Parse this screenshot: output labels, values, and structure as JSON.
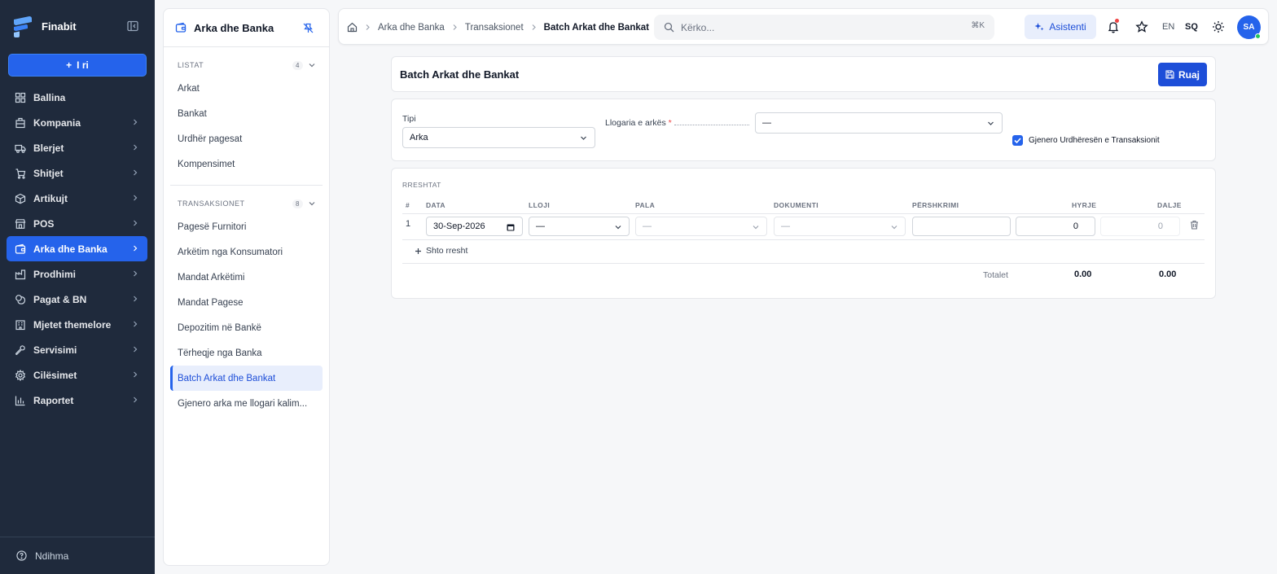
{
  "app": {
    "name": "Finabit",
    "new_label": "I ri",
    "help_label": "Ndihma"
  },
  "nav": {
    "items": [
      {
        "label": "Ballina",
        "icon": "dashboard-icon"
      },
      {
        "label": "Kompania",
        "icon": "building-icon"
      },
      {
        "label": "Blerjet",
        "icon": "truck-icon"
      },
      {
        "label": "Shitjet",
        "icon": "cart-icon"
      },
      {
        "label": "Artikujt",
        "icon": "box-icon"
      },
      {
        "label": "POS",
        "icon": "store-icon"
      },
      {
        "label": "Arka dhe Banka",
        "icon": "wallet-icon",
        "active": true
      },
      {
        "label": "Prodhimi",
        "icon": "factory-icon"
      },
      {
        "label": "Pagat & BN",
        "icon": "coins-icon"
      },
      {
        "label": "Mjetet themelore",
        "icon": "assets-icon"
      },
      {
        "label": "Servisimi",
        "icon": "wrench-icon"
      },
      {
        "label": "Cilësimet",
        "icon": "gear-icon"
      },
      {
        "label": "Raportet",
        "icon": "chart-icon"
      }
    ]
  },
  "panel": {
    "title": "Arka dhe Banka",
    "sections": [
      {
        "title": "LISTAT",
        "count": "4",
        "items": [
          "Arkat",
          "Bankat",
          "Urdhër pagesat",
          "Kompensimet"
        ]
      },
      {
        "title": "TRANSAKSIONET",
        "count": "8",
        "items": [
          "Pagesë Furnitori",
          "Arkëtim nga Konsumatori",
          "Mandat Arkëtimi",
          "Mandat Pagese",
          "Depozitim në Bankë",
          "Tërheqje nga Banka",
          "Batch Arkat dhe Bankat",
          "Gjenero arka me llogari kalim..."
        ]
      }
    ]
  },
  "topbar": {
    "crumbs": [
      "Arka dhe Banka",
      "Transaksionet",
      "Batch Arkat dhe Bankat"
    ],
    "search_placeholder": "Kërko...",
    "search_shortcut": "⌘K",
    "assistant_label": "Asistenti",
    "lang_en": "EN",
    "lang_sq": "SQ",
    "avatar_initials": "SA"
  },
  "page": {
    "title": "Batch Arkat dhe Bankat",
    "save_label": "Ruaj",
    "tipi_label": "Tipi",
    "tipi_value": "Arka",
    "llogaria_label": "Llogaria e arkës",
    "llogaria_value": "—",
    "generate_label": "Gjenero Urdhëresën e Transaksionit",
    "generate_checked": true
  },
  "rows": {
    "section_title": "RRESHTAT",
    "headers": [
      "#",
      "DATA",
      "LLOJI",
      "PALA",
      "DOKUMENTI",
      "PËRSHKRIMI",
      "HYRJE",
      "DALJE"
    ],
    "items": [
      {
        "num": "1",
        "date": "30-Sep-2026",
        "lloji": "—",
        "pala": "—",
        "dokumenti": "—",
        "pershkrimi": "",
        "hyrje": "0",
        "dalje": "0"
      }
    ],
    "add_label": "Shto rresht",
    "totals_label": "Totalet",
    "total_hyrje": "0.00",
    "total_dalje": "0.00"
  },
  "colors": {
    "sidebar_bg": "#1f2a3c",
    "accent": "#2563eb"
  }
}
